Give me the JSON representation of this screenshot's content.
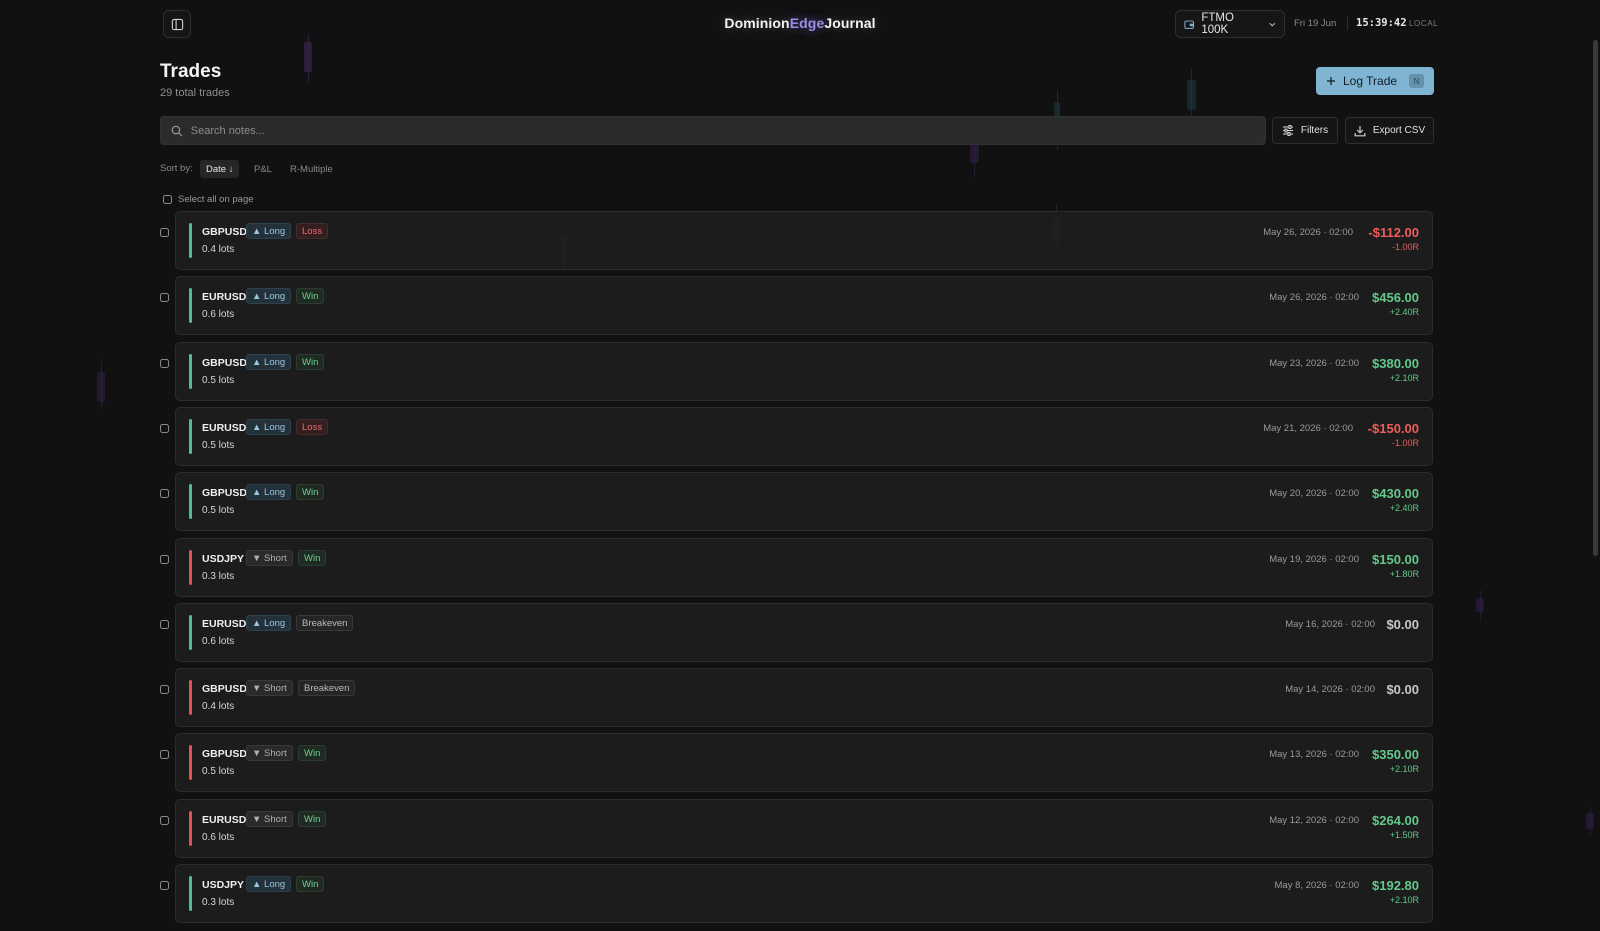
{
  "app": {
    "brand_part1": "Dominion",
    "brand_part2": "Edge",
    "brand_part3": "Journal",
    "brand_accent": "#9b8ce0"
  },
  "header": {
    "sidebar_toggle_icon": "panel-left-icon",
    "account_label": "FTMO 100K",
    "date": "Fri 19 Jun",
    "time": "15:39:42",
    "timezone": "LOCAL"
  },
  "page": {
    "title": "Trades",
    "subtitle": "29 total trades",
    "log_button_label": "Log Trade",
    "log_button_shortcut": "N",
    "log_button_color": "#7fb5d3"
  },
  "search": {
    "placeholder": "Search notes...",
    "value": ""
  },
  "toolbar": {
    "filters_label": "Filters",
    "export_label": "Export CSV"
  },
  "sort": {
    "label": "Sort by:",
    "options": [
      "Date ↓",
      "P&L",
      "R-Multiple"
    ],
    "active": "Date ↓"
  },
  "select_all_label": "Select all on page",
  "trades": [
    {
      "symbol": "GBPUSD",
      "direction": "▲ Long",
      "dir": "long",
      "result": "Loss",
      "res": "loss",
      "lots": "0.4 lots",
      "date": "May 26, 2026 · 02:00",
      "pnl": "-$112.00",
      "pnl_sign": "neg",
      "r": "-1.00R"
    },
    {
      "symbol": "EURUSD",
      "direction": "▲ Long",
      "dir": "long",
      "result": "Win",
      "res": "win",
      "lots": "0.6 lots",
      "date": "May 26, 2026 · 02:00",
      "pnl": "$456.00",
      "pnl_sign": "pos",
      "r": "+2.40R"
    },
    {
      "symbol": "GBPUSD",
      "direction": "▲ Long",
      "dir": "long",
      "result": "Win",
      "res": "win",
      "lots": "0.5 lots",
      "date": "May 23, 2026 · 02:00",
      "pnl": "$380.00",
      "pnl_sign": "pos",
      "r": "+2.10R"
    },
    {
      "symbol": "EURUSD",
      "direction": "▲ Long",
      "dir": "long",
      "result": "Loss",
      "res": "loss",
      "lots": "0.5 lots",
      "date": "May 21, 2026 · 02:00",
      "pnl": "-$150.00",
      "pnl_sign": "neg",
      "r": "-1.00R"
    },
    {
      "symbol": "GBPUSD",
      "direction": "▲ Long",
      "dir": "long",
      "result": "Win",
      "res": "win",
      "lots": "0.5 lots",
      "date": "May 20, 2026 · 02:00",
      "pnl": "$430.00",
      "pnl_sign": "pos",
      "r": "+2.40R"
    },
    {
      "symbol": "USDJPY",
      "direction": "▼ Short",
      "dir": "short",
      "result": "Win",
      "res": "win",
      "lots": "0.3 lots",
      "date": "May 19, 2026 · 02:00",
      "pnl": "$150.00",
      "pnl_sign": "pos",
      "r": "+1.80R"
    },
    {
      "symbol": "EURUSD",
      "direction": "▲ Long",
      "dir": "long",
      "result": "Breakeven",
      "res": "be",
      "lots": "0.6 lots",
      "date": "May 16, 2026 · 02:00",
      "pnl": "$0.00",
      "pnl_sign": "zero",
      "r": ""
    },
    {
      "symbol": "GBPUSD",
      "direction": "▼ Short",
      "dir": "short",
      "result": "Breakeven",
      "res": "be",
      "lots": "0.4 lots",
      "date": "May 14, 2026 · 02:00",
      "pnl": "$0.00",
      "pnl_sign": "zero",
      "r": ""
    },
    {
      "symbol": "GBPUSD",
      "direction": "▼ Short",
      "dir": "short",
      "result": "Win",
      "res": "win",
      "lots": "0.5 lots",
      "date": "May 13, 2026 · 02:00",
      "pnl": "$350.00",
      "pnl_sign": "pos",
      "r": "+2.10R"
    },
    {
      "symbol": "EURUSD",
      "direction": "▼ Short",
      "dir": "short",
      "result": "Win",
      "res": "win",
      "lots": "0.6 lots",
      "date": "May 12, 2026 · 02:00",
      "pnl": "$264.00",
      "pnl_sign": "pos",
      "r": "+1.50R"
    },
    {
      "symbol": "USDJPY",
      "direction": "▲ Long",
      "dir": "long",
      "result": "Win",
      "res": "win",
      "lots": "0.3 lots",
      "date": "May 8, 2026 · 02:00",
      "pnl": "$192.80",
      "pnl_sign": "pos",
      "r": "+2.10R"
    }
  ]
}
